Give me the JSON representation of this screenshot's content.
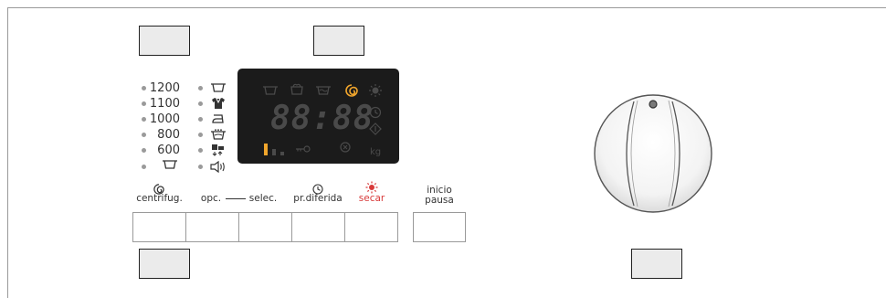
{
  "spin_speeds": [
    "1200",
    "1100",
    "1000",
    "800",
    "600"
  ],
  "options": [
    {
      "icon": "tub-icon"
    },
    {
      "icon": "shirt-icon"
    },
    {
      "icon": "iron-icon"
    },
    {
      "icon": "prewash-tub-icon"
    },
    {
      "icon": "extra-rinse-icon"
    },
    {
      "icon": "sound-icon"
    }
  ],
  "display": {
    "time": "88:88",
    "phase_icons": [
      "wash-icon",
      "soak-icon",
      "rinse-icon",
      "spin-icon",
      "dry-icon"
    ],
    "side_icons": [
      "clock-icon",
      "start-diamond-icon"
    ],
    "bottom": {
      "kg_label": "kg"
    },
    "colors": {
      "active": "#f0a52c",
      "inactive": "#4a4a4a"
    }
  },
  "buttons": {
    "spin_label": "centrifug.",
    "options_label": "opc.",
    "select_label": "selec.",
    "delay_label": "pr.diferida",
    "dry_label": "secar",
    "start_line1": "inicio",
    "start_line2": "pausa"
  },
  "colors": {
    "dry_accent": "#d83a3a",
    "callout_fill": "#ebebeb",
    "display_bg": "#1b1b1b"
  }
}
